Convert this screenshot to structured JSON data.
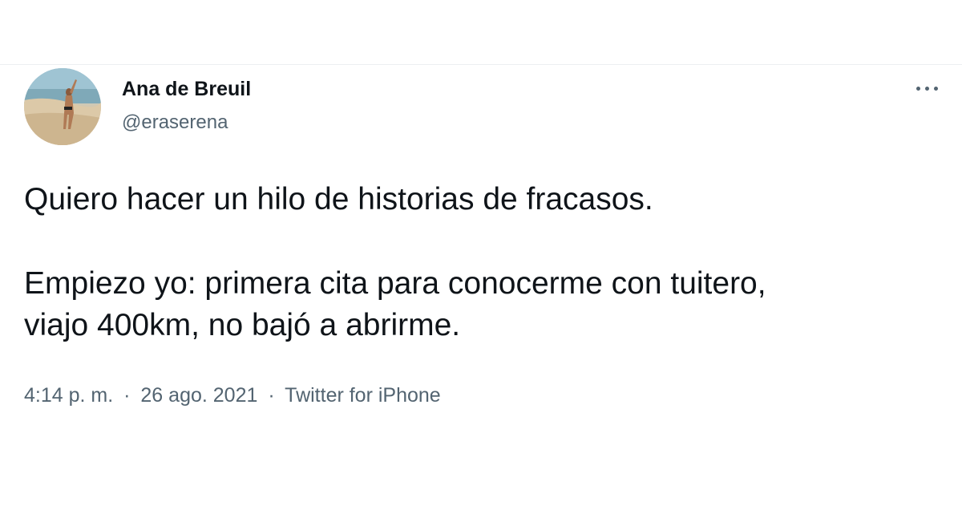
{
  "tweet": {
    "author": {
      "display_name": "Ana de Breuil",
      "handle": "@eraserena",
      "avatar_icon": "beach-photo-avatar"
    },
    "more_icon": "more-horizontal-icon",
    "text_paragraphs": [
      "Quiero hacer un hilo de historias de fracasos.",
      "Empiezo yo: primera cita para conocerme con tuitero,",
      "viajo 400km, no bajó a abrirme."
    ],
    "meta": {
      "time": "4:14 p. m.",
      "separator": "·",
      "date": "26 ago. 2021",
      "source": "Twitter for iPhone"
    }
  },
  "colors": {
    "text_primary": "#0f1419",
    "text_secondary": "#536471",
    "divider": "#eceff1"
  }
}
